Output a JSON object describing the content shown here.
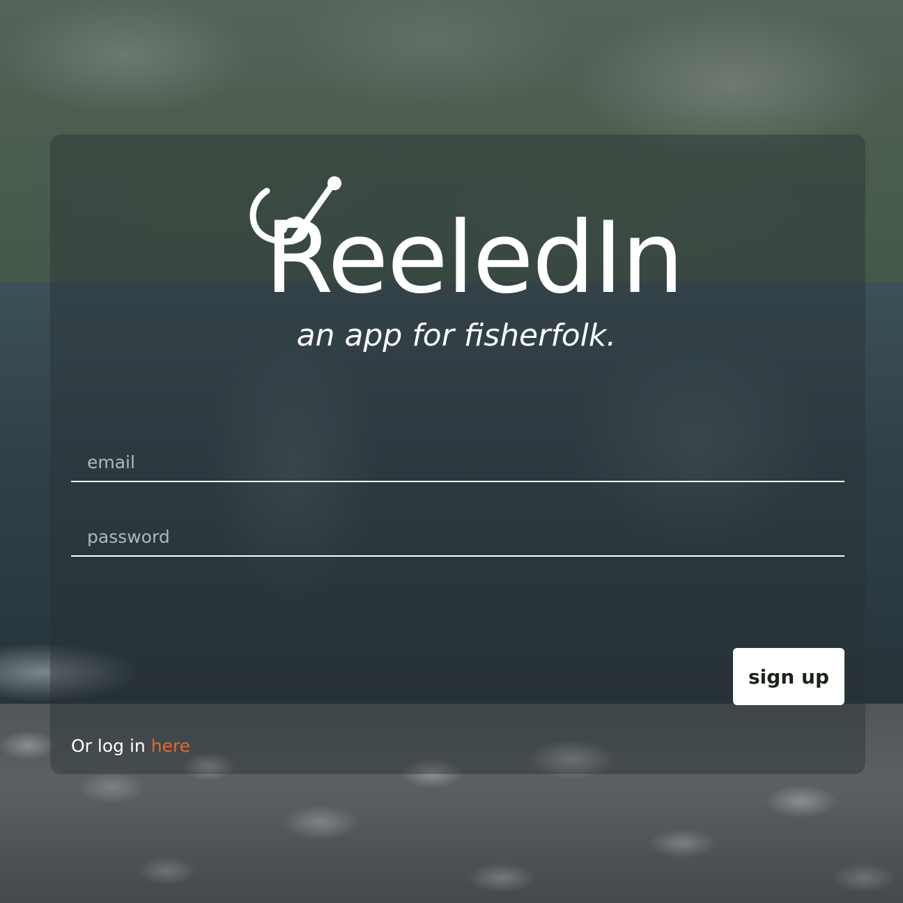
{
  "brand": {
    "name": "ReeledIn",
    "tagline": "an app for fisherfolk."
  },
  "form": {
    "email_placeholder": "email",
    "email_value": "",
    "password_placeholder": "password",
    "password_value": "",
    "submit_label": "sign up"
  },
  "footer": {
    "prompt": "Or log in ",
    "link_label": "here"
  },
  "colors": {
    "accent": "#e26a2c",
    "button_bg": "#ffffff",
    "button_text": "#1a2418",
    "text": "#ffffff"
  },
  "icons": {
    "logo_mark": "fishing-hook-icon"
  }
}
